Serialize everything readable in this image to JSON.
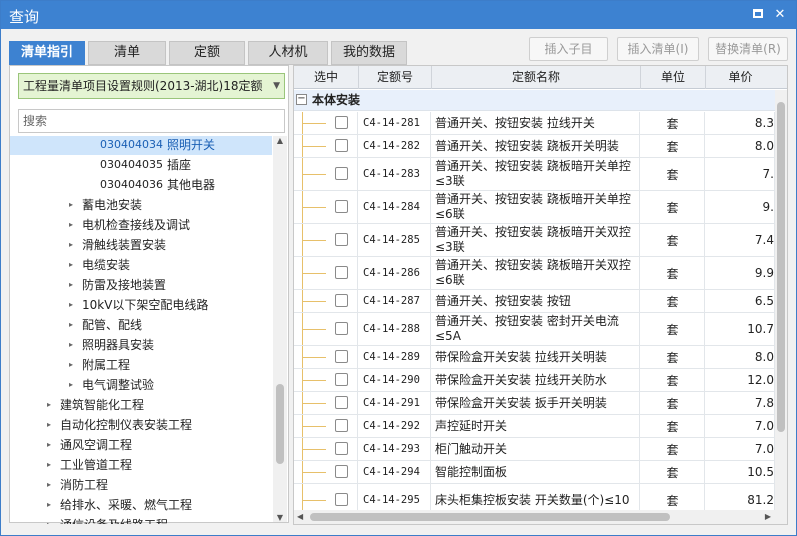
{
  "window": {
    "title": "查询"
  },
  "tabs": [
    {
      "label": "清单指引",
      "active": true
    },
    {
      "label": "清单",
      "active": false
    },
    {
      "label": "定额",
      "active": false
    },
    {
      "label": "人材机",
      "active": false
    },
    {
      "label": "我的数据",
      "active": false
    }
  ],
  "toolbar": {
    "insert_child": "插入子目",
    "insert_list": "插入清单(I)",
    "replace_list": "替换清单(R)"
  },
  "left": {
    "rule_value": "工程量清单项目设置规则(2013-湖北)18定额",
    "search_placeholder": "搜索",
    "tree": [
      {
        "code": "030404034",
        "label": "照明开关",
        "level": 3,
        "selected": true
      },
      {
        "code": "030404035",
        "label": "插座",
        "level": 3
      },
      {
        "code": "030404036",
        "label": "其他电器",
        "level": 3
      },
      {
        "label": "蓄电池安装",
        "level": 2
      },
      {
        "label": "电机检查接线及调试",
        "level": 2
      },
      {
        "label": "滑触线装置安装",
        "level": 2
      },
      {
        "label": "电缆安装",
        "level": 2
      },
      {
        "label": "防雷及接地装置",
        "level": 2
      },
      {
        "label": "10kV以下架空配电线路",
        "level": 2
      },
      {
        "label": "配管、配线",
        "level": 2
      },
      {
        "label": "照明器具安装",
        "level": 2
      },
      {
        "label": "附属工程",
        "level": 2
      },
      {
        "label": "电气调整试验",
        "level": 2
      },
      {
        "label": "建筑智能化工程",
        "level": 1
      },
      {
        "label": "自动化控制仪表安装工程",
        "level": 1
      },
      {
        "label": "通风空调工程",
        "level": 1
      },
      {
        "label": "工业管道工程",
        "level": 1
      },
      {
        "label": "消防工程",
        "level": 1
      },
      {
        "label": "给排水、采暖、燃气工程",
        "level": 1
      },
      {
        "label": "通信设备及线路工程",
        "level": 1
      }
    ]
  },
  "grid": {
    "headers": {
      "select": "选中",
      "code": "定额号",
      "name": "定额名称",
      "unit": "单位",
      "price": "单价"
    },
    "group_label": "本体安装",
    "group_toggle": "−",
    "rows": [
      {
        "code": "C4-14-281",
        "name": "普通开关、按钮安装 拉线开关",
        "unit": "套",
        "price": "8.3"
      },
      {
        "code": "C4-14-282",
        "name": "普通开关、按钮安装 跷板开关明装",
        "unit": "套",
        "price": "8.0"
      },
      {
        "code": "C4-14-283",
        "name": "普通开关、按钮安装 跷板暗开关单控≤3联",
        "unit": "套",
        "price": "7."
      },
      {
        "code": "C4-14-284",
        "name": "普通开关、按钮安装 跷板暗开关单控≤6联",
        "unit": "套",
        "price": "9."
      },
      {
        "code": "C4-14-285",
        "name": "普通开关、按钮安装 跷板暗开关双控≤3联",
        "unit": "套",
        "price": "7.4"
      },
      {
        "code": "C4-14-286",
        "name": "普通开关、按钮安装 跷板暗开关双控≤6联",
        "unit": "套",
        "price": "9.9"
      },
      {
        "code": "C4-14-287",
        "name": "普通开关、按钮安装 按钮",
        "unit": "套",
        "price": "6.5"
      },
      {
        "code": "C4-14-288",
        "name": "普通开关、按钮安装 密封开关电流≤5A",
        "unit": "套",
        "price": "10.7"
      },
      {
        "code": "C4-14-289",
        "name": "带保险盒开关安装 拉线开关明装",
        "unit": "套",
        "price": "8.0"
      },
      {
        "code": "C4-14-290",
        "name": "带保险盒开关安装 拉线开关防水",
        "unit": "套",
        "price": "12.0"
      },
      {
        "code": "C4-14-291",
        "name": "带保险盒开关安装 扳手开关明装",
        "unit": "套",
        "price": "7.8"
      },
      {
        "code": "C4-14-292",
        "name": "声控延时开关",
        "unit": "套",
        "price": "7.0"
      },
      {
        "code": "C4-14-293",
        "name": "柜门触动开关",
        "unit": "套",
        "price": "7.0"
      },
      {
        "code": "C4-14-294",
        "name": "智能控制面板",
        "unit": "套",
        "price": "10.5"
      },
      {
        "code": "C4-14-295",
        "name": "床头柜集控板安装 开关数量(个)≤10",
        "unit": "套",
        "price": "81.2"
      }
    ]
  },
  "icons": {
    "maximize": "maximize-icon",
    "close": "✕",
    "dropdown_arrow": "▼",
    "tree_expand": "▸",
    "scroll_up": "▲",
    "scroll_down": "▼",
    "scroll_left": "◀",
    "scroll_right": "▶"
  }
}
